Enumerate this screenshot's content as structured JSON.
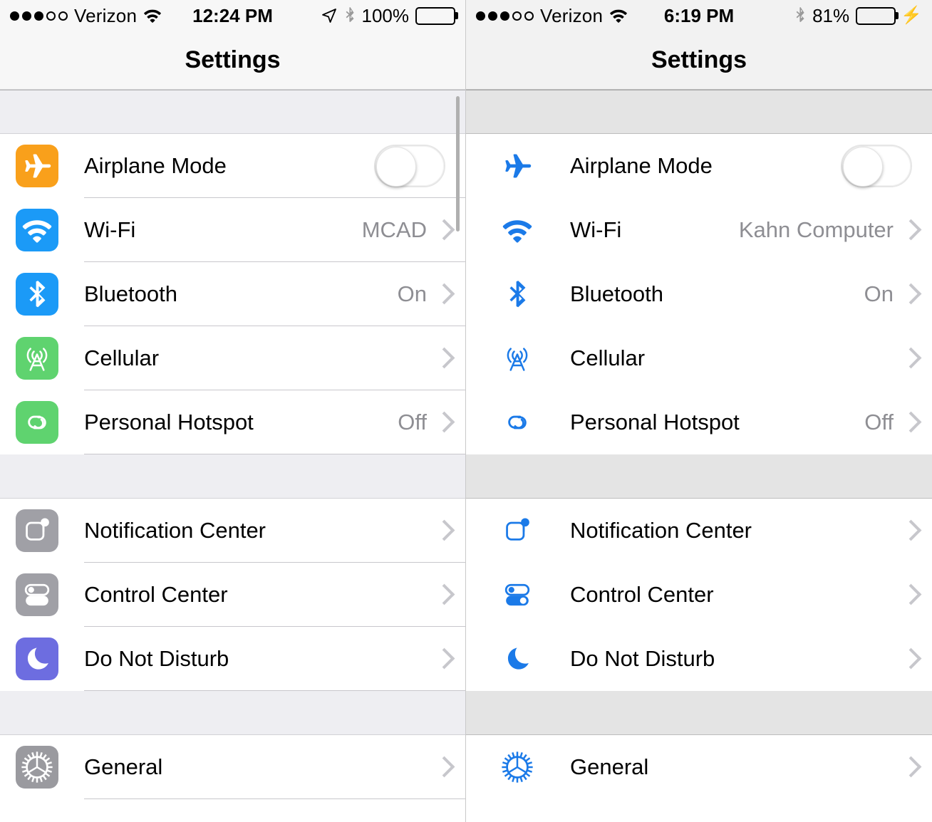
{
  "screens": [
    {
      "id": "left",
      "style": "colored-icons",
      "status": {
        "signal_filled": 3,
        "signal_empty": 2,
        "carrier": "Verizon",
        "wifi_icon": "wifi-icon",
        "time": "12:24 PM",
        "location_icon": "location-arrow-icon",
        "bluetooth_icon": "bluetooth-icon",
        "battery_percent": "100%",
        "battery_level": 100,
        "battery_color": "#000000",
        "charging": false
      },
      "navbar": {
        "title": "Settings"
      },
      "groups": [
        {
          "rows": [
            {
              "icon": "airplane-icon",
              "icon_color": "#f9a01b",
              "label": "Airplane Mode",
              "control": "toggle",
              "toggle_on": false
            },
            {
              "icon": "wifi-icon",
              "icon_color": "#1b9af7",
              "label": "Wi-Fi",
              "value": "MCAD",
              "control": "chevron"
            },
            {
              "icon": "bluetooth-icon",
              "icon_color": "#1b9af7",
              "label": "Bluetooth",
              "value": "On",
              "control": "chevron"
            },
            {
              "icon": "cellular-icon",
              "icon_color": "#5fd36f",
              "label": "Cellular",
              "value": "",
              "control": "chevron"
            },
            {
              "icon": "hotspot-icon",
              "icon_color": "#5fd36f",
              "label": "Personal Hotspot",
              "value": "Off",
              "control": "chevron"
            }
          ]
        },
        {
          "rows": [
            {
              "icon": "notification-center-icon",
              "icon_color": "#a0a0a6",
              "label": "Notification Center",
              "value": "",
              "control": "chevron"
            },
            {
              "icon": "control-center-icon",
              "icon_color": "#a0a0a6",
              "label": "Control Center",
              "value": "",
              "control": "chevron"
            },
            {
              "icon": "moon-icon",
              "icon_color": "#6d6de0",
              "label": "Do Not Disturb",
              "value": "",
              "control": "chevron"
            }
          ]
        },
        {
          "rows": [
            {
              "icon": "gear-icon",
              "icon_color": "#9a9a9f",
              "label": "General",
              "value": "",
              "control": "chevron"
            }
          ]
        }
      ]
    },
    {
      "id": "right",
      "style": "monochrome-icons",
      "status": {
        "signal_filled": 3,
        "signal_empty": 2,
        "carrier": "Verizon",
        "wifi_icon": "wifi-icon",
        "time": "6:19 PM",
        "bluetooth_icon": "bluetooth-icon",
        "battery_percent": "81%",
        "battery_level": 81,
        "battery_color": "#4cd964",
        "charging": true
      },
      "navbar": {
        "title": "Settings"
      },
      "groups": [
        {
          "rows": [
            {
              "icon": "airplane-icon",
              "icon_color": "#1b7ae8",
              "label": "Airplane Mode",
              "control": "toggle",
              "toggle_on": false
            },
            {
              "icon": "wifi-icon",
              "icon_color": "#1b7ae8",
              "label": "Wi-Fi",
              "value": "Kahn Computer",
              "control": "chevron"
            },
            {
              "icon": "bluetooth-icon",
              "icon_color": "#1b7ae8",
              "label": "Bluetooth",
              "value": "On",
              "control": "chevron"
            },
            {
              "icon": "cellular-icon",
              "icon_color": "#1b7ae8",
              "label": "Cellular",
              "value": "",
              "control": "chevron"
            },
            {
              "icon": "hotspot-icon",
              "icon_color": "#1b7ae8",
              "label": "Personal Hotspot",
              "value": "Off",
              "control": "chevron"
            }
          ]
        },
        {
          "rows": [
            {
              "icon": "notification-center-icon",
              "icon_color": "#1b7ae8",
              "label": "Notification Center",
              "value": "",
              "control": "chevron"
            },
            {
              "icon": "control-center-icon",
              "icon_color": "#1b7ae8",
              "label": "Control Center",
              "value": "",
              "control": "chevron"
            },
            {
              "icon": "moon-icon",
              "icon_color": "#1b7ae8",
              "label": "Do Not Disturb",
              "value": "",
              "control": "chevron"
            }
          ]
        },
        {
          "rows": [
            {
              "icon": "gear-icon",
              "icon_color": "#1b7ae8",
              "label": "General",
              "value": "",
              "control": "chevron"
            }
          ]
        }
      ]
    }
  ]
}
